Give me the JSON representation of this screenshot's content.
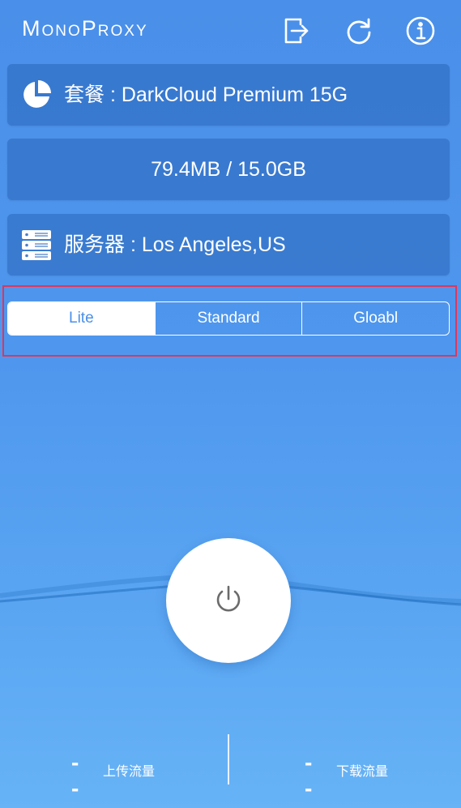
{
  "app": {
    "title": "MonoProxy"
  },
  "toolbar": {
    "exit_icon": "logout-icon",
    "refresh_icon": "refresh-icon",
    "info_icon": "info-icon"
  },
  "plan": {
    "label": "套餐 : DarkCloud Premium 15G",
    "icon": "pie-chart-icon"
  },
  "usage": {
    "text": "79.4MB / 15.0GB"
  },
  "server": {
    "label": "服务器 : Los Angeles,US",
    "icon": "server-icon"
  },
  "mode": {
    "options": [
      "Lite",
      "Standard",
      "Gloabl"
    ],
    "selected": "Lite"
  },
  "power": {
    "icon": "power-icon"
  },
  "stats": {
    "upload": {
      "value": "--",
      "label": "上传流量"
    },
    "download": {
      "value": "--",
      "label": "下载流量"
    }
  },
  "colors": {
    "background_top": "#4a8fe9",
    "background_bottom": "#67b3f6",
    "card": "#2966ba",
    "highlight": "#e0365a",
    "text": "#ffffff"
  }
}
